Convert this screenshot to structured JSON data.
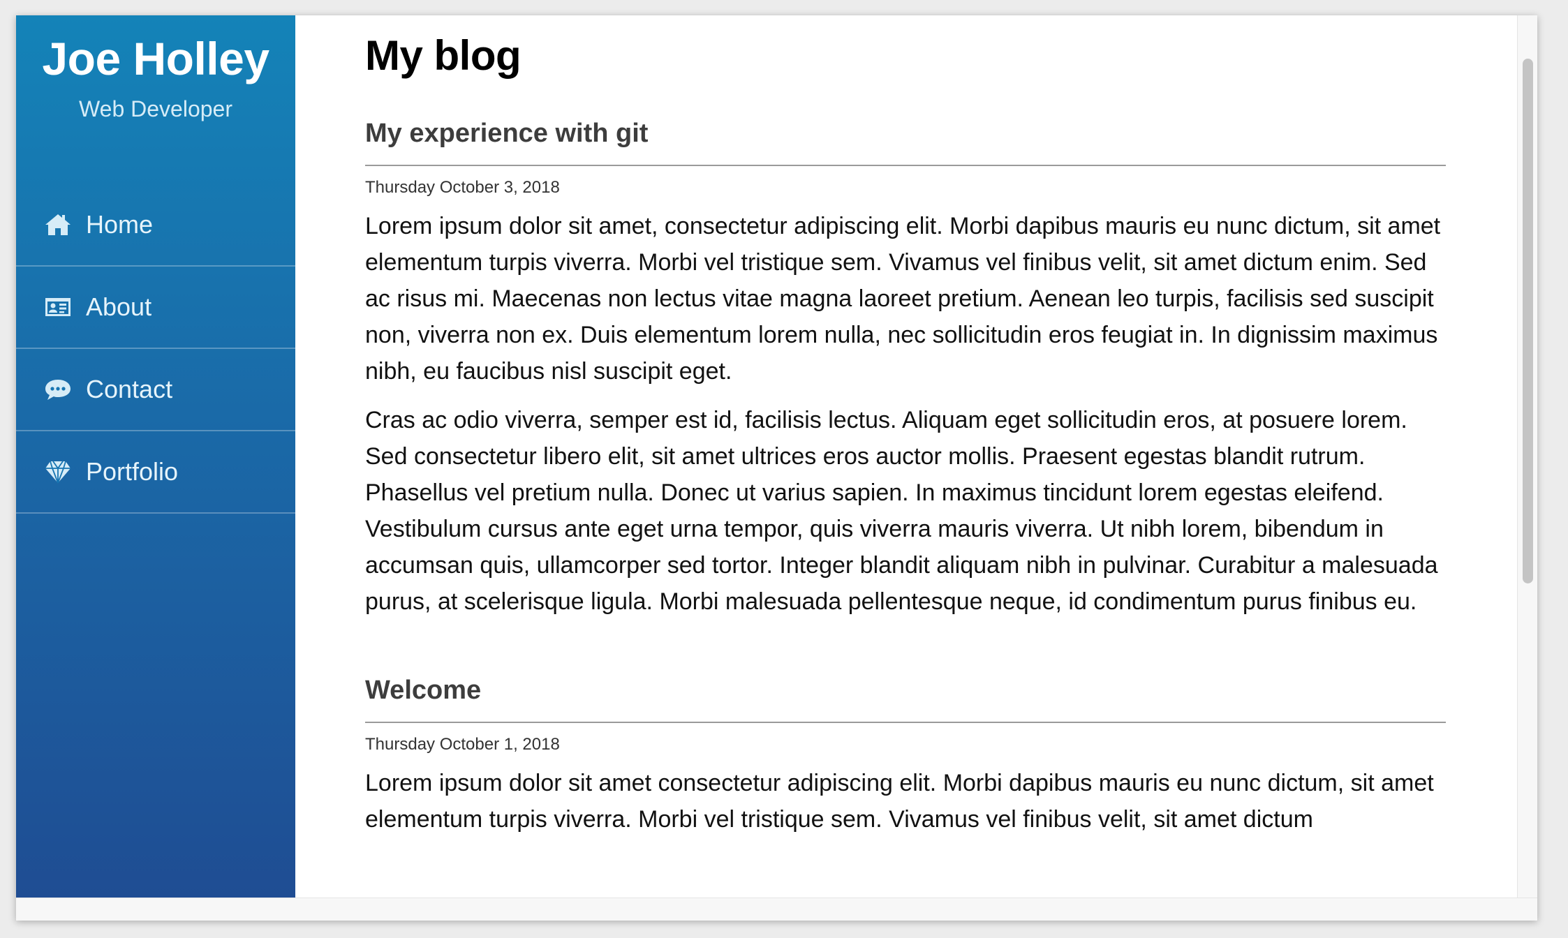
{
  "brand": {
    "name": "Joe Holley",
    "role": "Web Developer"
  },
  "nav": {
    "items": [
      {
        "label": "Home",
        "icon": "home-icon"
      },
      {
        "label": "About",
        "icon": "id-card-icon"
      },
      {
        "label": "Contact",
        "icon": "chat-bubble-icon"
      },
      {
        "label": "Portfolio",
        "icon": "diamond-icon"
      }
    ]
  },
  "page": {
    "title": "My blog"
  },
  "posts": [
    {
      "title": "My experience with git",
      "date": "Thursday October 3, 2018",
      "paragraphs": [
        "Lorem ipsum dolor sit amet, consectetur adipiscing elit. Morbi dapibus mauris eu nunc dictum, sit amet elementum turpis viverra. Morbi vel tristique sem. Vivamus vel finibus velit, sit amet dictum enim. Sed ac risus mi. Maecenas non lectus vitae magna laoreet pretium. Aenean leo turpis, facilisis sed suscipit non, viverra non ex. Duis elementum lorem nulla, nec sollicitudin eros feugiat in. In dignissim maximus nibh, eu faucibus nisl suscipit eget.",
        "Cras ac odio viverra, semper est id, facilisis lectus. Aliquam eget sollicitudin eros, at posuere lorem. Sed consectetur libero elit, sit amet ultrices eros auctor mollis. Praesent egestas blandit rutrum. Phasellus vel pretium nulla. Donec ut varius sapien. In maximus tincidunt lorem egestas eleifend. Vestibulum cursus ante eget urna tempor, quis viverra mauris viverra. Ut nibh lorem, bibendum in accumsan quis, ullamcorper sed tortor. Integer blandit aliquam nibh in pulvinar. Curabitur a malesuada purus, at scelerisque ligula. Morbi malesuada pellentesque neque, id condimentum purus finibus eu."
      ]
    },
    {
      "title": "Welcome",
      "date": "Thursday October 1, 2018",
      "paragraphs": [
        "Lorem ipsum dolor sit amet consectetur adipiscing elit. Morbi dapibus mauris eu nunc dictum, sit amet elementum turpis viverra. Morbi vel tristique sem. Vivamus vel finibus velit, sit amet dictum"
      ]
    }
  ],
  "colors": {
    "sidebar_top": "#1483b8",
    "sidebar_bottom": "#1f4d93",
    "nav_text": "#e6f4fb"
  }
}
